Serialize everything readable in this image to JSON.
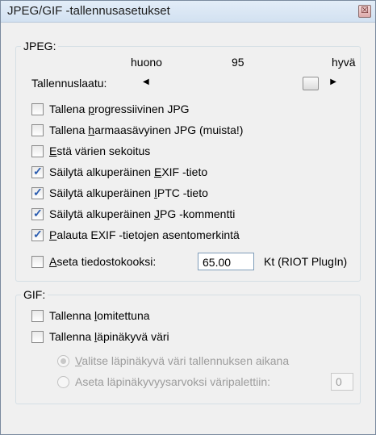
{
  "window": {
    "title": "JPEG/GIF -tallennusasetukset",
    "close_glyph": "☒"
  },
  "jpeg": {
    "legend": "JPEG:",
    "quality_low": "huono",
    "quality_value": "95",
    "quality_high": "hyvä",
    "quality_label": "Tallennuslaatu:",
    "quality_level": 0.95,
    "checkboxes": [
      {
        "pre": "Tallena ",
        "u": "p",
        "post": "rogressiivinen JPG",
        "checked": false
      },
      {
        "pre": "Tallena ",
        "u": "h",
        "post": "armaasävyinen JPG (muista!)",
        "checked": false
      },
      {
        "pre": "",
        "u": "E",
        "post": "stä värien sekoitus",
        "checked": false
      },
      {
        "pre": "Säilytä alkuperäinen ",
        "u": "E",
        "post": "XIF -tieto",
        "checked": true
      },
      {
        "pre": "Säilytä alkuperäinen ",
        "u": "I",
        "post": "PTC -tieto",
        "checked": true
      },
      {
        "pre": "Säilytä alkuperäinen ",
        "u": "J",
        "post": "PG -kommentti",
        "checked": true
      },
      {
        "pre": "",
        "u": "P",
        "post": "alauta EXIF -tietojen asentomerkintä",
        "checked": true
      }
    ],
    "filesize": {
      "pre": "",
      "u": "A",
      "post": "seta tiedostokooksi:",
      "value": "65.00",
      "unit": "Kt (RIOT PlugIn)",
      "checked": false
    }
  },
  "gif": {
    "legend": "GIF:",
    "checkboxes": [
      {
        "pre": "Tallenna ",
        "u": "l",
        "post": "omitettuna",
        "checked": false
      },
      {
        "pre": "Tallenna ",
        "u": "l",
        "post": "äpinäkyvä väri",
        "checked": false
      }
    ],
    "radios": [
      {
        "pre": "",
        "u": "V",
        "post": "alitse läpinäkyvä väri tallennuksen aikana",
        "selected": true
      },
      {
        "pre": "Aseta läpinäkyvyysarvoksi väripalettiin:",
        "u": "",
        "post": "",
        "selected": false
      }
    ],
    "palette_value": "0"
  }
}
